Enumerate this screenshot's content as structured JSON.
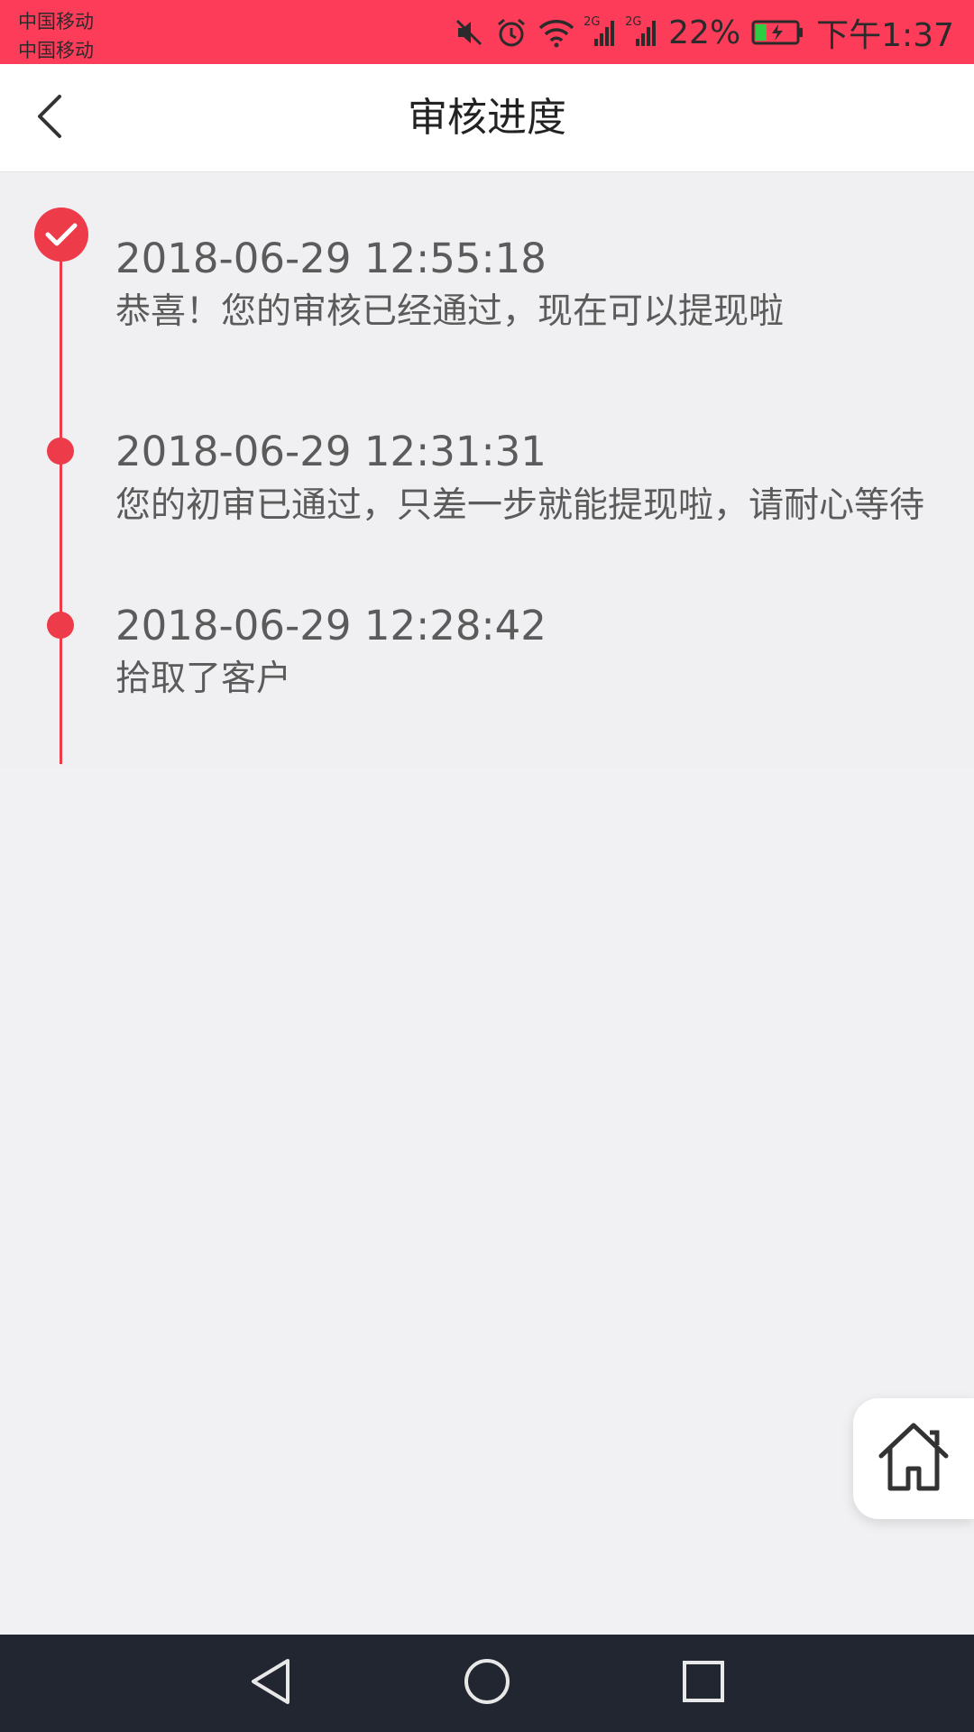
{
  "status_bar": {
    "carrier_1": "中国移动",
    "carrier_2": "中国移动",
    "network_1": "2G",
    "network_2": "2G",
    "battery_percent": "22%",
    "time": "下午1:37",
    "icons": [
      "mute-icon",
      "alarm-icon",
      "wifi-icon",
      "signal-icon",
      "signal-icon",
      "battery-charging-icon"
    ]
  },
  "header": {
    "title": "审核进度",
    "back_icon": "chevron-left-icon"
  },
  "timeline": {
    "accent_color": "#ee3b49",
    "entries": [
      {
        "time": "2018-06-29 12:55:18",
        "desc": "恭喜！您的审核已经通过，现在可以提现啦",
        "marker": "check-icon"
      },
      {
        "time": "2018-06-29 12:31:31",
        "desc": "您的初审已通过，只差一步就能提现啦，请耐心等待",
        "marker": "dot"
      },
      {
        "time": "2018-06-29 12:28:42",
        "desc": "拾取了客户",
        "marker": "dot"
      }
    ]
  },
  "home_button": {
    "icon": "home-icon"
  },
  "nav_bar": {
    "icons": [
      "back-triangle-icon",
      "home-circle-icon",
      "recents-square-icon"
    ]
  },
  "colors": {
    "status_bar": "#fd3c5a",
    "nav_bar": "#222630",
    "background": "#f1f1f3"
  }
}
